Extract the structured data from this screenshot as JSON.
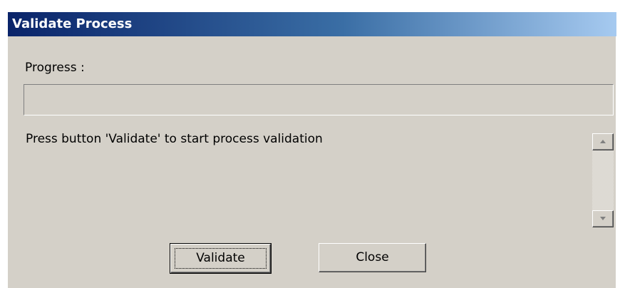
{
  "dialog": {
    "title": "Validate Process",
    "progress_label": "Progress :",
    "progress_value": 0,
    "message": "Press button 'Validate' to start process validation",
    "buttons": {
      "validate_label": "Validate",
      "close_label": "Close"
    }
  },
  "icons": {
    "scroll_up": "triangle-up-icon",
    "scroll_down": "triangle-down-icon"
  },
  "colors": {
    "title_gradient_start": "#0a246a",
    "title_gradient_end": "#a6caf0",
    "dialog_background": "#d4d0c8"
  }
}
